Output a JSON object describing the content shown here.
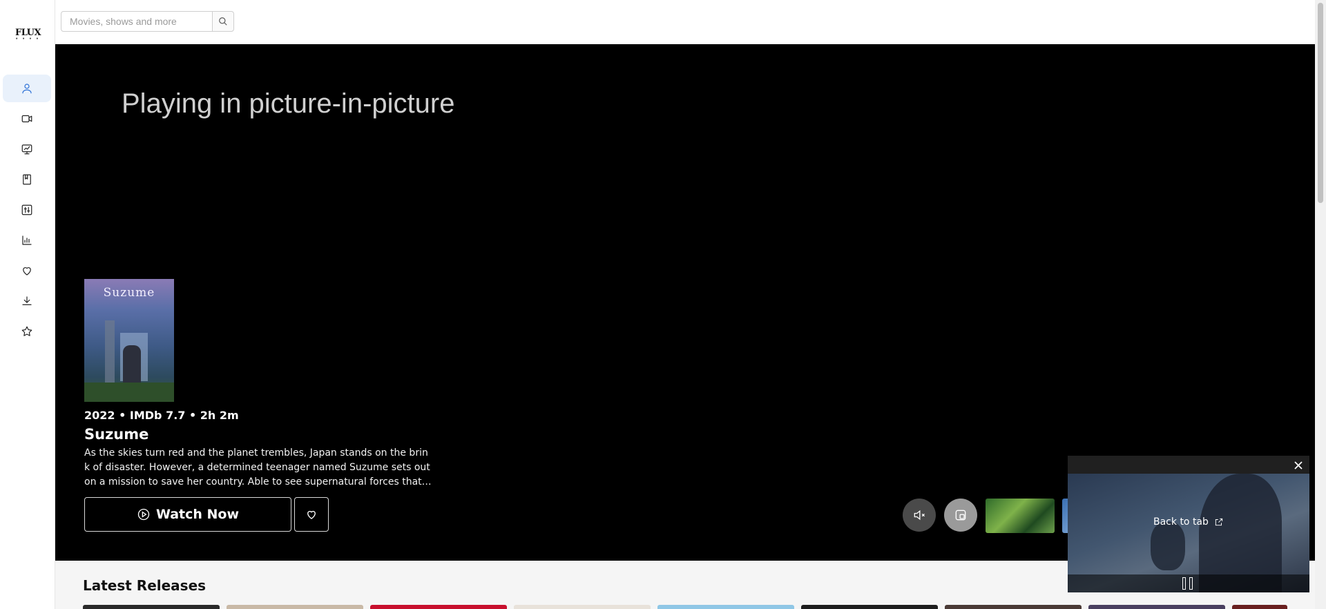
{
  "app": {
    "logo_text": "FLUX",
    "logo_subtext": "• • • •"
  },
  "sidebar": {
    "items": [
      {
        "name": "profile",
        "icon": "user-icon",
        "active": true
      },
      {
        "name": "movies",
        "icon": "video-camera-icon",
        "active": false
      },
      {
        "name": "tv-shows",
        "icon": "tv-icon",
        "active": false
      },
      {
        "name": "library",
        "icon": "bookmark-book-icon",
        "active": false
      },
      {
        "name": "filters",
        "icon": "sliders-icon",
        "active": false
      },
      {
        "name": "stats",
        "icon": "bar-chart-icon",
        "active": false
      },
      {
        "name": "favorites",
        "icon": "heart-icon",
        "active": false
      },
      {
        "name": "downloads",
        "icon": "download-icon",
        "active": false
      },
      {
        "name": "ratings",
        "icon": "star-icon",
        "active": false
      }
    ]
  },
  "search": {
    "placeholder": "Movies, shows and more",
    "value": ""
  },
  "hero": {
    "pip_message": "Playing in picture-in-picture",
    "poster_title": "Suzume",
    "meta": "2022 • IMDb 7.7 • 2h 2m",
    "title": "Suzume",
    "description": "As the skies turn red and the planet trembles, Japan stands on the brink of disaster. However, a determined teenager named Suzume sets out on a mission to save her country. Able to see supernatural forces that others cannot, she finds herself journeying to doors that cause disasters across Japan.",
    "watch_label": "Watch Now"
  },
  "pip": {
    "back_label": "Back to tab"
  },
  "latest": {
    "title": "Latest Releases"
  },
  "colors": {
    "accent": "#2a6fd6",
    "hero_bg": "#000000",
    "page_bg": "#f5f5f5"
  }
}
